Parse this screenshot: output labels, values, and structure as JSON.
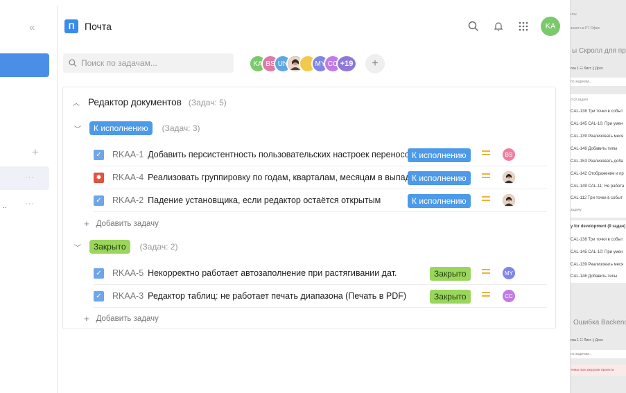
{
  "sidebar": {
    "collapse_icon": "«",
    "add_icon": "+",
    "more_icon": "···",
    "ellipsis_text": ".."
  },
  "header": {
    "logo_letter": "П",
    "app_name": "Почта",
    "avatar_initials": "KA",
    "colors": {
      "accent": "#3a8bea",
      "avatar": "#7ac96b"
    }
  },
  "search": {
    "placeholder": "Поиск по задачам..."
  },
  "members": {
    "avatars": [
      {
        "initials": "KA",
        "color": "#7ac96b"
      },
      {
        "initials": "BS",
        "color": "#e07aa6"
      },
      {
        "initials": "UN",
        "color": "#5ea7e0"
      },
      {
        "initials": "",
        "color": "#6b6b6b"
      },
      {
        "initials": "",
        "color": "#f2c94c"
      },
      {
        "initials": "MY",
        "color": "#7f86e6"
      },
      {
        "initials": "CC",
        "color": "#c07ce4"
      }
    ],
    "more": "+19",
    "add": "+"
  },
  "project": {
    "title": "Редактор документов",
    "count": "(Задач: 5)",
    "groups": [
      {
        "status": "К исполнению",
        "count": "(Задач: 3)",
        "tasks": [
          {
            "key": "RKAA-1",
            "title": "Добавить персистентность пользовательских настроек переносов",
            "status": "К исполнению",
            "assignee": "BS",
            "assignee_color": "#ef7fa0"
          },
          {
            "key": "RKAA-4",
            "title": "Реализовать группировку по годам, кварталам, месяцам в выпадающем ...",
            "status": "К исполнению",
            "assignee": "",
            "assignee_color": "#6b4a3a"
          },
          {
            "key": "RKAA-2",
            "title": "Падение установщика, если редактор остаётся открытым",
            "status": "К исполнению",
            "assignee": "",
            "assignee_color": "#6b4a3a"
          }
        ],
        "add_label": "Добавить задачу"
      },
      {
        "status": "Закрыто",
        "count": "(Задач: 2)",
        "tasks": [
          {
            "key": "RKAA-5",
            "title": "Некорректно работает автозаполнение при растягивании дат.",
            "status": "Закрыто",
            "assignee": "MY",
            "assignee_color": "#7f86e6"
          },
          {
            "key": "RKAA-3",
            "title": "Редактор таблиц: не работает печать диапазона (Печать в PDF)",
            "status": "Закрыто",
            "assignee": "CC",
            "assignee_color": "#c07ce4"
          }
        ],
        "add_label": "Добавить задачу"
      }
    ]
  },
  "right_panel": {
    "line1": "нты",
    "line2": "знает на Р7-Офис",
    "title1": "ы Скролл для про",
    "tabs1": "пка 1   ☷ Лист   ▯ Доск",
    "search1": "по задачам...",
    "group1": "л (9 задач)",
    "items1": [
      "CAL-138  Три точки в событ",
      "CAL-145  CAL-10: При умен",
      "CAL-139  Реализовать меся",
      "CAL-146  Добавить типы",
      "CAL-153  Реализовать доба",
      "CAL-142  Отображение и пр",
      "CAL-149  CAL-11: Не работа",
      "CAL-112  Три точки в событ"
    ],
    "add1": "задачу",
    "group2": "y for development (9 задач)",
    "items2": [
      "CAL-138  Три точки в событ",
      "CAL-145  CAL-10: При умен",
      "CAL-139  Реализовать меся",
      "CAL-146  Добавить типы"
    ],
    "title2": "Ошибка Backend",
    "tabs2": "пка 1   ☷ Лист   ▯ Доск",
    "search2": "по задачам...",
    "error": "темы при загрузке проекта"
  }
}
